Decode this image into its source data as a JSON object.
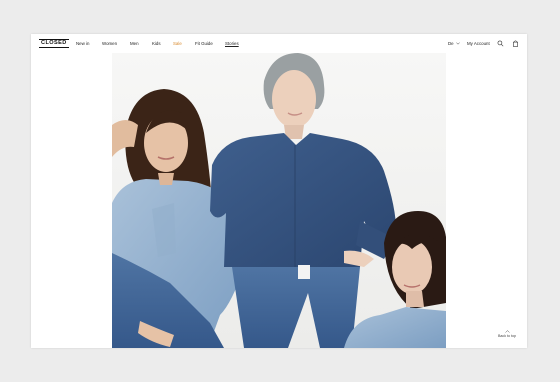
{
  "header": {
    "logo": "CLOSED",
    "nav": [
      {
        "label": "New in"
      },
      {
        "label": "Women"
      },
      {
        "label": "Men"
      },
      {
        "label": "Kids"
      },
      {
        "label": "Sale"
      },
      {
        "label": "Fit Guide"
      },
      {
        "label": "Stories"
      }
    ],
    "language": "De",
    "account": "My Account",
    "icons": [
      "chevron-down-icon",
      "search-icon",
      "bag-icon"
    ],
    "sale_color": "#d88a2e"
  },
  "hero": {
    "image": "three-models-in-denim-photo"
  },
  "footer": {
    "back_to_top": "Back to top"
  }
}
